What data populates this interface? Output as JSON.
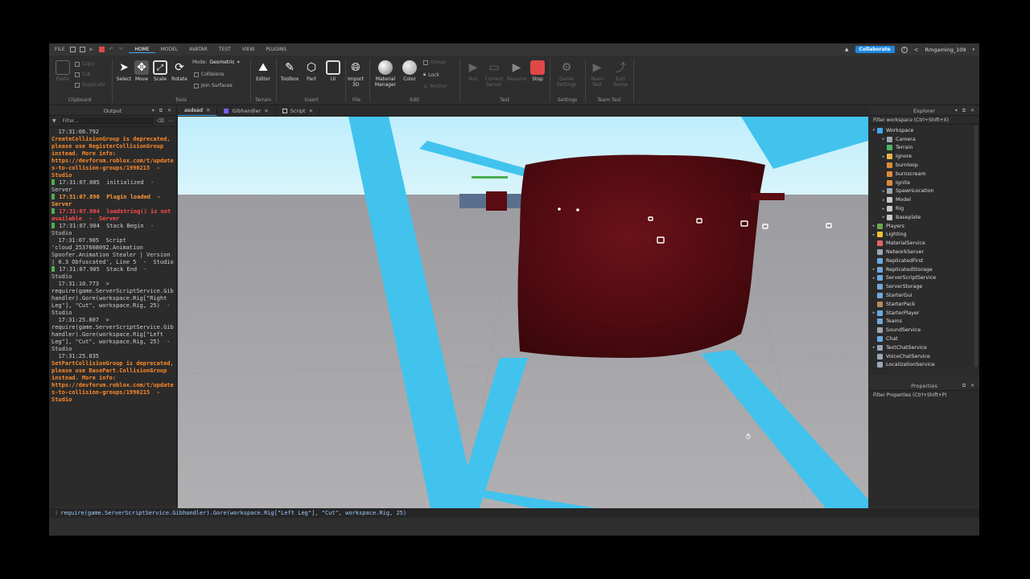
{
  "menubar": {
    "items": [
      "FILE",
      "HOME",
      "MODEL",
      "AVATAR",
      "TEST",
      "VIEW",
      "PLUGINS"
    ],
    "active": "HOME",
    "collaborate_label": "Collaborate",
    "username": "Rmgaming_109"
  },
  "ribbon": {
    "clipboard": {
      "paste": "Paste",
      "copy": "Copy",
      "cut": "Cut",
      "duplicate": "Duplicate",
      "label": "Clipboard"
    },
    "tools": {
      "select": "Select",
      "move": "Move",
      "scale": "Scale",
      "rotate": "Rotate",
      "mode_label": "Mode:",
      "mode_value": "Geometric",
      "collisions": "Collisions",
      "join_surfaces": "Join Surfaces",
      "label": "Tools"
    },
    "terrain": {
      "editor": "Editor",
      "label": "Terrain"
    },
    "insert": {
      "toolbox": "Toolbox",
      "part": "Part",
      "ui": "UI",
      "label": "Insert"
    },
    "file": {
      "import3d": "Import 3D",
      "label": "File"
    },
    "edit": {
      "material_manager": "Material Manager",
      "color": "Color",
      "group": "Group",
      "lock": "Lock",
      "anchor": "Anchor",
      "label": "Edit"
    },
    "test": {
      "run": "Run",
      "current_server": "Current Server",
      "resume": "Resume",
      "stop": "Stop",
      "label": "Test"
    },
    "settings": {
      "game_settings": "Game Settings",
      "label": "Settings"
    },
    "team_test": {
      "team_test": "Team Test",
      "exit_game": "Exit Game",
      "label": "Team Test"
    }
  },
  "output": {
    "title": "Output",
    "filter_placeholder": "Filter...",
    "lines": [
      {
        "style": "normal",
        "bar": false,
        "text": "  17:31:06.792"
      },
      {
        "style": "orange",
        "bar": false,
        "text": "CreateCollisionGroup is deprecated, please use RegisterCollisionGroup instead. More info: https://devforum.roblox.com/t/updates-to-collision-groups/1990215  -  Studio"
      },
      {
        "style": "normal",
        "bar": true,
        "text": " 17:31:07.085  initialized  -  Server"
      },
      {
        "style": "orange-b",
        "bar": true,
        "text": " 17:31:07.890  Plugin loaded  -  Server"
      },
      {
        "style": "red",
        "bar": true,
        "text": " 17:31:07.904  loadstring() is not available  -  Server"
      },
      {
        "style": "normal",
        "bar": true,
        "text": " 17:31:07.904  Stack Begin  -  Studio"
      },
      {
        "style": "normal",
        "bar": false,
        "text": "  17:31:07.905  Script 'cloud_2537608092.Animation Spoofer.Animation Stealer | Version | 0.3 Obfuscated', Line 5  -  Studio"
      },
      {
        "style": "normal",
        "bar": true,
        "text": " 17:31:07.905  Stack End  -  Studio"
      },
      {
        "style": "normal",
        "bar": false,
        "text": "  17:31:10.773  > require(game.ServerScriptService.Gibhandler).Gore(workspace.Rig[\"Right Leg\"], \"Cut\", workspace.Rig, 25)  -  Studio"
      },
      {
        "style": "normal",
        "bar": false,
        "text": "  17:31:25.807  > require(game.ServerScriptService.Gibhandler).Gore(workspace.Rig[\"Left Leg\"], \"Cut\", workspace.Rig, 25)  -  Studio"
      },
      {
        "style": "normal",
        "bar": false,
        "text": "  17:31:25.835"
      },
      {
        "style": "orange",
        "bar": false,
        "text": "SetPartCollisionGroup is deprecated, please use BasePart.CollisionGroup instead. More info: https://devforum.roblox.com/t/updates-to-collision-groups/1990215  -  Studio"
      }
    ]
  },
  "tabs": [
    {
      "label": "asdsad",
      "active": true,
      "color": "#2e2e2e"
    },
    {
      "label": "Gibhandler",
      "active": false,
      "color": "#7b5cff"
    },
    {
      "label": "Script",
      "active": false,
      "color": "#cccccc"
    }
  ],
  "explorer": {
    "title": "Explorer",
    "filter_placeholder": "Filter workspace (Ctrl+Shift+X)",
    "nodes": [
      {
        "label": "Workspace",
        "depth": 0,
        "arrow": "▾",
        "color": "#3fa9f5"
      },
      {
        "label": "Camera",
        "depth": 1,
        "arrow": "▸",
        "color": "#9aa7b5"
      },
      {
        "label": "Terrain",
        "depth": 1,
        "arrow": "",
        "color": "#49b96b"
      },
      {
        "label": "Ignore",
        "depth": 1,
        "arrow": "▸",
        "color": "#e8b84a"
      },
      {
        "label": "burnloop",
        "depth": 1,
        "arrow": "",
        "color": "#e08a3a"
      },
      {
        "label": "burnscream",
        "depth": 1,
        "arrow": "",
        "color": "#e08a3a"
      },
      {
        "label": "Ignite",
        "depth": 1,
        "arrow": "",
        "color": "#e08a3a"
      },
      {
        "label": "SpawnLocation",
        "depth": 1,
        "arrow": "▸",
        "color": "#9aa7b5"
      },
      {
        "label": "Model",
        "depth": 1,
        "arrow": "▸",
        "color": "#c9c9c9"
      },
      {
        "label": "Rig",
        "depth": 1,
        "arrow": "▸",
        "color": "#c9c9c9"
      },
      {
        "label": "Baseplate",
        "depth": 1,
        "arrow": "▸",
        "color": "#c9c9c9"
      },
      {
        "label": "Players",
        "depth": 0,
        "arrow": "▸",
        "color": "#6aa84f"
      },
      {
        "label": "Lighting",
        "depth": 0,
        "arrow": "▸",
        "color": "#f1c232"
      },
      {
        "label": "MaterialService",
        "depth": 0,
        "arrow": "",
        "color": "#e06666"
      },
      {
        "label": "NetworkServer",
        "depth": 0,
        "arrow": "",
        "color": "#9aa7b5"
      },
      {
        "label": "ReplicatedFirst",
        "depth": 0,
        "arrow": "",
        "color": "#6fa8dc"
      },
      {
        "label": "ReplicatedStorage",
        "depth": 0,
        "arrow": "▸",
        "color": "#6fa8dc"
      },
      {
        "label": "ServerScriptService",
        "depth": 0,
        "arrow": "▸",
        "color": "#6fa8dc"
      },
      {
        "label": "ServerStorage",
        "depth": 0,
        "arrow": "",
        "color": "#6fa8dc"
      },
      {
        "label": "StarterGui",
        "depth": 0,
        "arrow": "",
        "color": "#6fa8dc"
      },
      {
        "label": "StarterPack",
        "depth": 0,
        "arrow": "",
        "color": "#b58a5a"
      },
      {
        "label": "StarterPlayer",
        "depth": 0,
        "arrow": "▸",
        "color": "#6fa8dc"
      },
      {
        "label": "Teams",
        "depth": 0,
        "arrow": "",
        "color": "#6fa8dc"
      },
      {
        "label": "SoundService",
        "depth": 0,
        "arrow": "",
        "color": "#9aa7b5"
      },
      {
        "label": "Chat",
        "depth": 0,
        "arrow": "",
        "color": "#6fa8dc"
      },
      {
        "label": "TextChatService",
        "depth": 0,
        "arrow": "▸",
        "color": "#9aa7b5"
      },
      {
        "label": "VoiceChatService",
        "depth": 0,
        "arrow": "",
        "color": "#9aa7b5"
      },
      {
        "label": "LocalizationService",
        "depth": 0,
        "arrow": "",
        "color": "#9aa7b5"
      }
    ]
  },
  "properties": {
    "title": "Properties",
    "filter_placeholder": "Filter Properties (Ctrl+Shift+P)"
  },
  "command_bar": {
    "value": "require(game.ServerScriptService.Gibhandler).Gore(workspace.Rig[\"Left Leg\"], \"Cut\", workspace.Rig, 25)"
  },
  "viewport": {
    "sky": "#c5eefb",
    "ground": "#a8a8ac",
    "beam": "#41c3ee",
    "block": "#5a0d12"
  }
}
